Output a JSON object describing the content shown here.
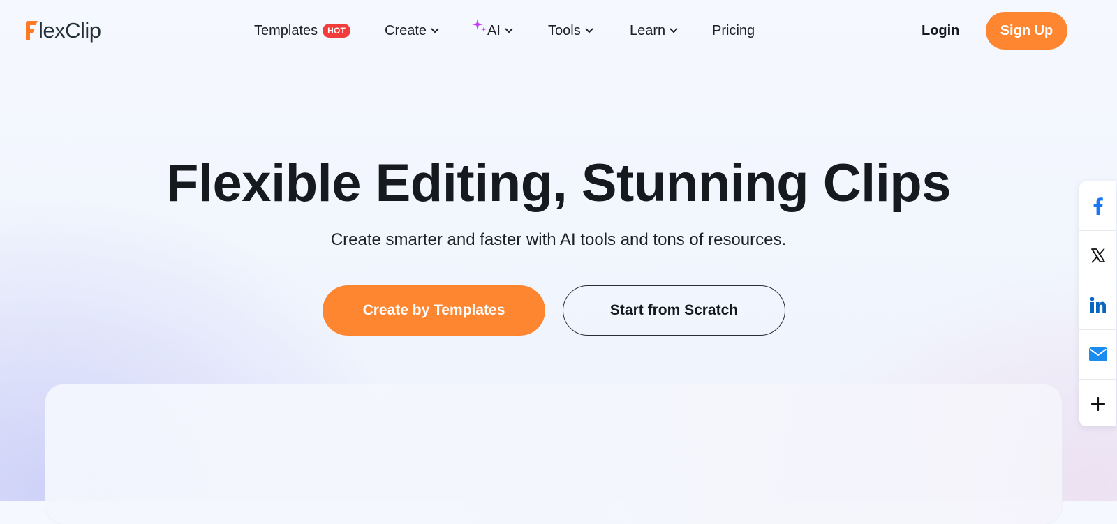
{
  "brand": {
    "name": "FlexClip",
    "logo_letter": "F",
    "logo_rest": "lexClip",
    "accent_color": "#ff8630"
  },
  "nav": {
    "items": [
      {
        "label": "Templates",
        "badge": "HOT",
        "dropdown": false
      },
      {
        "label": "Create",
        "dropdown": true,
        "icon": "chevron-down-icon"
      },
      {
        "label": "AI",
        "dropdown": true,
        "icon": "sparkle-icon"
      },
      {
        "label": "Tools",
        "dropdown": true,
        "icon": "chevron-down-icon"
      },
      {
        "label": "Learn",
        "dropdown": true,
        "icon": "chevron-down-icon"
      },
      {
        "label": "Pricing",
        "dropdown": false
      }
    ],
    "login_label": "Login",
    "signup_label": "Sign Up"
  },
  "hero": {
    "title": "Flexible Editing, Stunning Clips",
    "subtitle": "Create smarter and faster with AI tools and tons of resources.",
    "primary_cta": "Create by Templates",
    "secondary_cta": "Start from Scratch"
  },
  "share_bar": {
    "items": [
      {
        "icon": "facebook-icon",
        "color": "#1877f2"
      },
      {
        "icon": "x-twitter-icon",
        "color": "#111111"
      },
      {
        "icon": "linkedin-icon",
        "color": "#0a66c2"
      },
      {
        "icon": "email-icon",
        "color": "#1a8cf0"
      },
      {
        "icon": "plus-icon",
        "color": "#111111"
      }
    ]
  },
  "colors": {
    "hot_badge": "#f23b3b",
    "ai_sparkle": "#c13cf5",
    "text_dark": "#16191e"
  }
}
